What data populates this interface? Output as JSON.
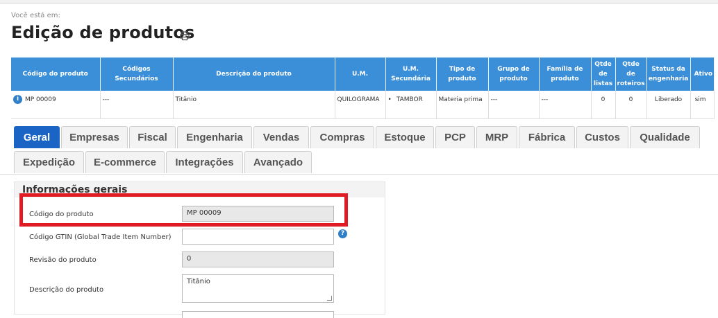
{
  "breadcrumb": "Você está em:",
  "page_title": "Edição de produtos",
  "icons": {
    "print": "printer-icon",
    "info": "info-icon",
    "help": "help-icon"
  },
  "colors": {
    "header_bg": "#3a8fd8",
    "tab_active": "#1a64c6",
    "highlight": "#e01b24",
    "readonly_bg": "#e8e8e8"
  },
  "table": {
    "columns": [
      "Código do produto",
      "Códigos Secundários",
      "Descrição do produto",
      "U.M.",
      "U.M. Secundária",
      "Tipo de produto",
      "Grupo de produto",
      "Família de produto",
      "Qtde de listas",
      "Qtde de roteiros",
      "Status da engenharia",
      "Ativo"
    ],
    "row": {
      "info_glyph": "i",
      "codigo": "MP 00009",
      "secundarios": "---",
      "descricao": "Titânio",
      "um": "QUILOGRAMA",
      "um_sec": "TAMBOR",
      "tipo": "Materia prima",
      "grupo": "---",
      "familia": "---",
      "qtde_listas": "0",
      "qtde_roteiros": "0",
      "status": "Liberado",
      "ativo": "sim"
    }
  },
  "tabs": [
    "Geral",
    "Empresas",
    "Fiscal",
    "Engenharia",
    "Vendas",
    "Compras",
    "Estoque",
    "PCP",
    "MRP",
    "Fábrica",
    "Custos",
    "Qualidade",
    "Expedição",
    "E-commerce",
    "Integrações",
    "Avançado"
  ],
  "active_tab": "Geral",
  "form": {
    "section_title": "Informações gerais",
    "help_glyph": "?",
    "fields": [
      {
        "label": "Código do produto",
        "value": "MP 00009",
        "readonly": true
      },
      {
        "label": "Código GTIN (Global Trade Item Number)",
        "value": "",
        "readonly": false
      },
      {
        "label": "Revisão do produto",
        "value": "0",
        "readonly": true
      },
      {
        "label": "Descrição do produto",
        "value": "Titânio",
        "readonly": false
      }
    ]
  }
}
